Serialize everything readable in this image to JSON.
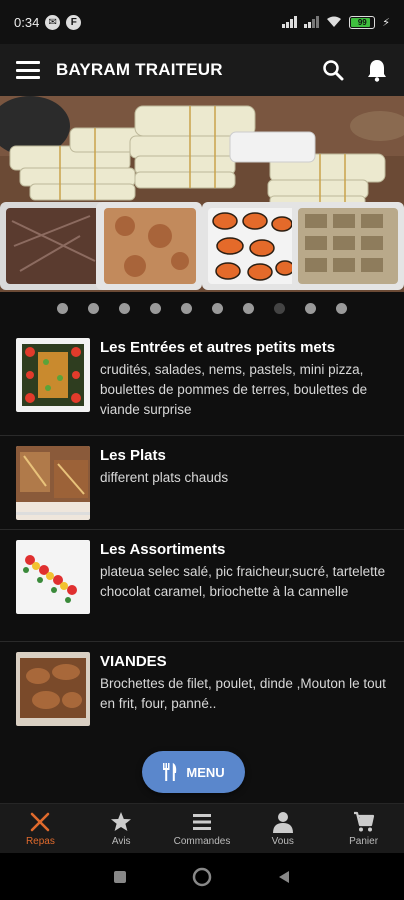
{
  "status": {
    "time": "0:34",
    "battery": "99"
  },
  "app_bar": {
    "title": "BAYRAM TRAITEUR"
  },
  "carousel": {
    "dot_count": 10,
    "active_index": 7
  },
  "items": [
    {
      "title": "Les Entrées et autres petits mets",
      "description": "crudités, salades, nems, pastels, mini pizza, boulettes de pommes de terres, boulettes de viande surprise"
    },
    {
      "title": "Les Plats",
      "description": "different plats chauds"
    },
    {
      "title": "Les Assortiments",
      "description": "plateua selec salé, pic fraicheur,sucré, tartelette chocolat caramel, briochette à la cannelle"
    },
    {
      "title": "VIANDES",
      "description": "Brochettes de filet, poulet, dinde ,Mouton le tout en frit, four, panné.."
    }
  ],
  "menu_button": {
    "label": "MENU"
  },
  "bottom_nav": [
    {
      "label": "Repas",
      "icon": "fork-knife-icon",
      "active": true
    },
    {
      "label": "Avis",
      "icon": "star-icon",
      "active": false
    },
    {
      "label": "Commandes",
      "icon": "list-icon",
      "active": false
    },
    {
      "label": "Vous",
      "icon": "person-icon",
      "active": false
    },
    {
      "label": "Panier",
      "icon": "cart-icon",
      "active": false
    }
  ],
  "colors": {
    "accent": "#e06a2c",
    "menu_button": "#5a87cc",
    "background": "#0f0f0f"
  }
}
